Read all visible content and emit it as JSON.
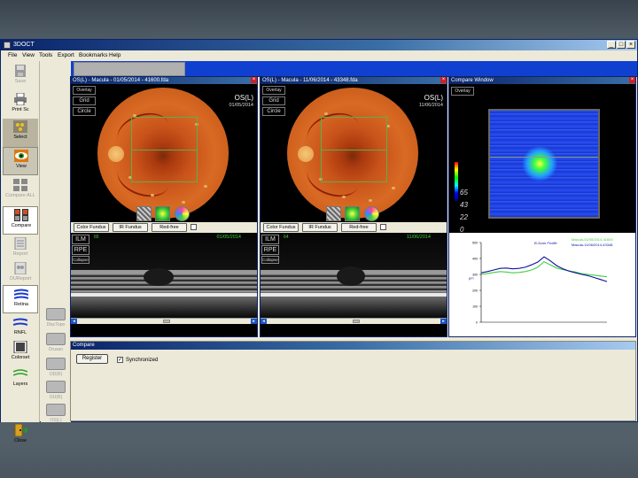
{
  "window": {
    "title": "3DOCT"
  },
  "menu": [
    "File",
    "View",
    "Tools",
    "Export",
    "Bookmarks",
    "Help"
  ],
  "toolbar": [
    {
      "label": "Save",
      "icon": "floppy-disk-icon",
      "enabled": false
    },
    {
      "label": "Print Sc",
      "icon": "printer-icon",
      "enabled": true
    },
    {
      "label": "Select",
      "icon": "select-icon",
      "enabled": true
    },
    {
      "label": "View",
      "icon": "eye-icon",
      "enabled": true,
      "selected": true
    },
    {
      "label": "Compare ALL",
      "icon": "compare-all-icon",
      "enabled": false
    },
    {
      "label": "Compare",
      "icon": "compare-icon",
      "enabled": true
    },
    {
      "label": "Report",
      "icon": "report-icon",
      "enabled": false
    },
    {
      "label": "OUReport",
      "icon": "ou-report-icon",
      "enabled": false
    },
    {
      "label": "Retina",
      "icon": "retina-icon",
      "enabled": true
    },
    {
      "label": "RNFL",
      "icon": "rnfl-icon",
      "enabled": true
    },
    {
      "label": "Colorset",
      "icon": "colorset-icon",
      "enabled": true
    },
    {
      "label": "Layers",
      "icon": "layers-icon",
      "enabled": true
    },
    {
      "label": "Close",
      "icon": "exit-door-icon",
      "enabled": true
    }
  ],
  "toolbar2": [
    {
      "label": "DiscTopo"
    },
    {
      "label": "Drusen"
    },
    {
      "label": "OD(R)"
    },
    {
      "label": "OU(R)"
    },
    {
      "label": "OS(L)"
    }
  ],
  "panels": [
    {
      "header": "OS(L) - Macula - 01/05/2014 - 41600.fda",
      "eye": "OS(L)",
      "date": "01/05/2014",
      "oct_date": "01/05/2014",
      "oct_num": "65"
    },
    {
      "header": "OS(L) - Macula - 11/06/2014 - 43348.fda",
      "eye": "OS(L)",
      "date": "11/06/2014",
      "oct_date": "11/06/2014",
      "oct_num": "64"
    }
  ],
  "overlay_buttons": [
    "Overlay",
    "Grid",
    "Circle"
  ],
  "fundus_buttons": [
    "Color Fundus",
    "IR Fundus",
    "Red-free"
  ],
  "oct_labels": [
    "ILM",
    "RPE",
    "Collapse"
  ],
  "compare_window": {
    "title": "Compare Window",
    "overlay": "Overlay",
    "colorbar": [
      "65",
      "43",
      "22",
      "0"
    ]
  },
  "profile": {
    "title": "B-Scan Profile",
    "ylabel": "μm",
    "legend": [
      "Macula-01/05/2014-41600",
      "Macula-11/06/2014-43348"
    ],
    "colors": [
      "#40d040",
      "#1010a0"
    ],
    "yticks": [
      "500",
      "400",
      "300",
      "200",
      "100",
      "0"
    ]
  },
  "chart_data": {
    "type": "line",
    "title": "B-Scan Profile",
    "ylabel": "μm",
    "ylim": [
      0,
      500
    ],
    "x": [
      0,
      5,
      10,
      15,
      20,
      25,
      30,
      35,
      40,
      45,
      50,
      55,
      60,
      65,
      70,
      75,
      80,
      85,
      90,
      95,
      100
    ],
    "series": [
      {
        "name": "Macula-01/05/2014-41600",
        "values": [
          300,
          305,
          312,
          318,
          315,
          310,
          312,
          318,
          328,
          345,
          380,
          360,
          340,
          330,
          322,
          315,
          305,
          300,
          295,
          290,
          285
        ]
      },
      {
        "name": "Macula-11/06/2014-43348",
        "values": [
          310,
          318,
          328,
          338,
          340,
          335,
          338,
          345,
          360,
          378,
          410,
          385,
          355,
          335,
          320,
          310,
          300,
          292,
          280,
          268,
          255
        ]
      }
    ]
  },
  "compare_section": {
    "title": "Compare",
    "register": "Register",
    "synchronized": "Synchronized",
    "synchronized_checked": true
  }
}
